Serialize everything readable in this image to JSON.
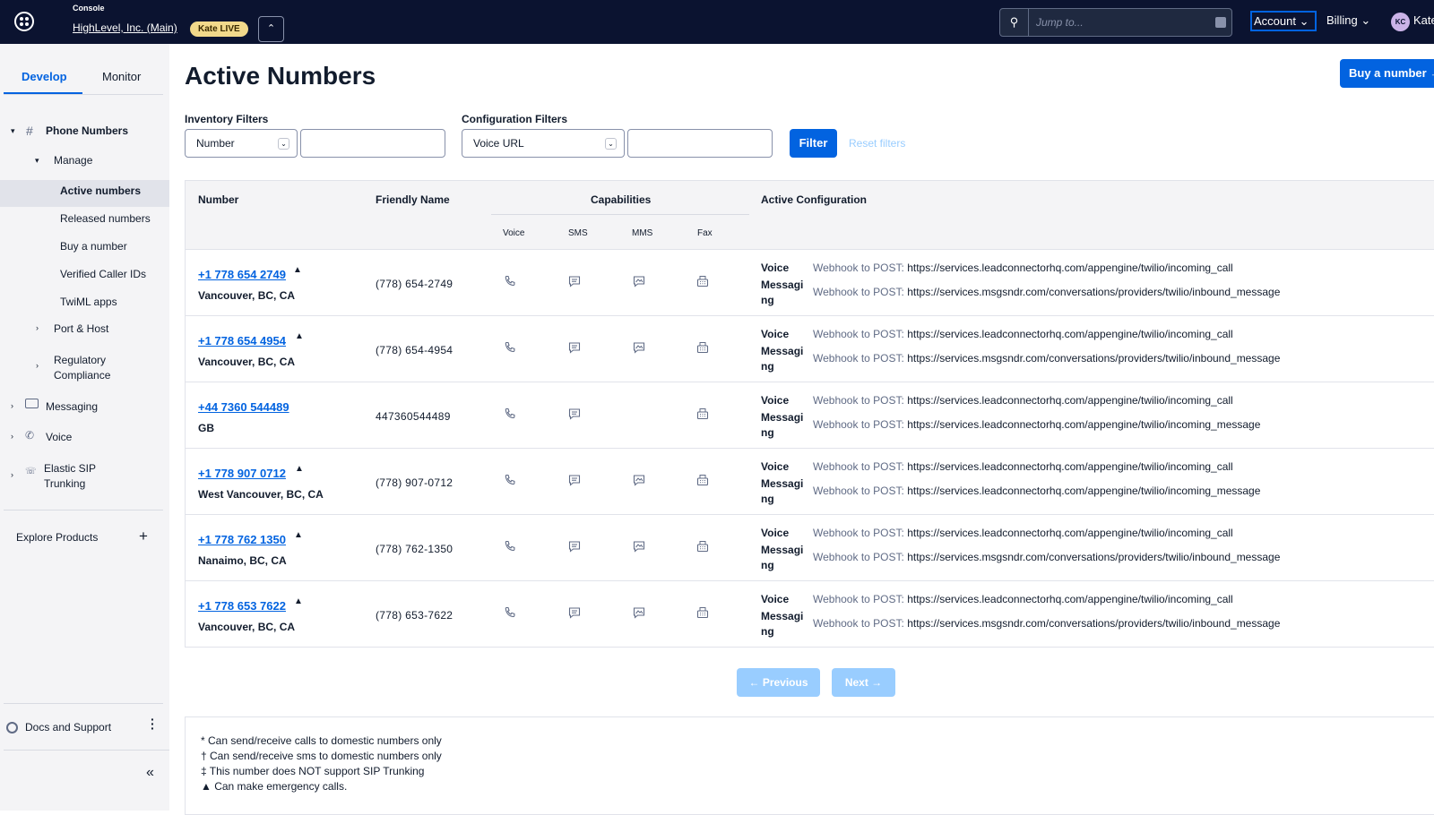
{
  "topbar": {
    "console_label": "Console",
    "account_name": "HighLevel, Inc. (Main)",
    "badge": "Kate LIVE",
    "switcher_icon": "chevron-up-down",
    "search_placeholder": "Jump to...",
    "account_menu": "Account",
    "billing_menu": "Billing",
    "avatar_initials": "KC",
    "user_name": "Kate"
  },
  "sidebar": {
    "tabs": [
      "Develop",
      "Monitor"
    ],
    "phone_numbers": "Phone Numbers",
    "manage": "Manage",
    "manage_items": [
      "Active numbers",
      "Released numbers",
      "Buy a number",
      "Verified Caller IDs",
      "TwiML apps"
    ],
    "port_host": "Port & Host",
    "regulatory": "Regulatory Compliance",
    "messaging": "Messaging",
    "voice": "Voice",
    "sip": "Elastic SIP Trunking",
    "explore": "Explore Products",
    "docs": "Docs and Support"
  },
  "main": {
    "title": "Active Numbers",
    "buy_button": "Buy a number",
    "inventory_label": "Inventory Filters",
    "inventory_select": "Number",
    "config_label": "Configuration Filters",
    "config_select": "Voice URL",
    "filter_button": "Filter",
    "reset_link": "Reset filters"
  },
  "table": {
    "headers": {
      "number": "Number",
      "friendly": "Friendly Name",
      "capabilities": "Capabilities",
      "config": "Active Configuration"
    },
    "cap_headers": [
      "Voice",
      "SMS",
      "MMS",
      "Fax"
    ],
    "config_voice_label": "Voice",
    "config_msg_label": "Messaging",
    "webhook_prefix": "Webhook to POST:",
    "rows": [
      {
        "number": "+1 778 654 2749",
        "emergency": true,
        "location": "Vancouver, BC, CA",
        "friendly": "(778) 654-2749",
        "mms": true,
        "voice_url": "https://services.leadconnectorhq.com/appengine/twilio/incoming_call",
        "msg_url": "https://services.msgsndr.com/conversations/providers/twilio/inbound_message"
      },
      {
        "number": "+1 778 654 4954",
        "emergency": true,
        "location": "Vancouver, BC, CA",
        "friendly": "(778) 654-4954",
        "mms": true,
        "voice_url": "https://services.leadconnectorhq.com/appengine/twilio/incoming_call",
        "msg_url": "https://services.msgsndr.com/conversations/providers/twilio/inbound_message"
      },
      {
        "number": "+44 7360 544489",
        "emergency": false,
        "location": "GB",
        "friendly": "447360544489",
        "mms": false,
        "voice_url": "https://services.leadconnectorhq.com/appengine/twilio/incoming_call",
        "msg_url": "https://services.leadconnectorhq.com/appengine/twilio/incoming_message"
      },
      {
        "number": "+1 778 907 0712",
        "emergency": true,
        "location": "West Vancouver, BC, CA",
        "friendly": "(778) 907-0712",
        "mms": true,
        "voice_url": "https://services.leadconnectorhq.com/appengine/twilio/incoming_call",
        "msg_url": "https://services.leadconnectorhq.com/appengine/twilio/incoming_message"
      },
      {
        "number": "+1 778 762 1350",
        "emergency": true,
        "location": "Nanaimo, BC, CA",
        "friendly": "(778) 762-1350",
        "mms": true,
        "voice_url": "https://services.leadconnectorhq.com/appengine/twilio/incoming_call",
        "msg_url": "https://services.msgsndr.com/conversations/providers/twilio/inbound_message"
      },
      {
        "number": "+1 778 653 7622",
        "emergency": true,
        "location": "Vancouver, BC, CA",
        "friendly": "(778) 653-7622",
        "mms": true,
        "voice_url": "https://services.leadconnectorhq.com/appengine/twilio/incoming_call",
        "msg_url": "https://services.msgsndr.com/conversations/providers/twilio/inbound_message"
      }
    ]
  },
  "pagination": {
    "previous": "← Previous",
    "next": "Next →"
  },
  "footnotes": [
    "* Can send/receive calls to domestic numbers only",
    "† Can send/receive sms to domestic numbers only",
    "‡ This number does NOT support SIP Trunking",
    "▲ Can make emergency calls."
  ],
  "colors": {
    "topbar": "#0b1330",
    "accent": "#0263e0",
    "disabled": "#99cdff"
  }
}
